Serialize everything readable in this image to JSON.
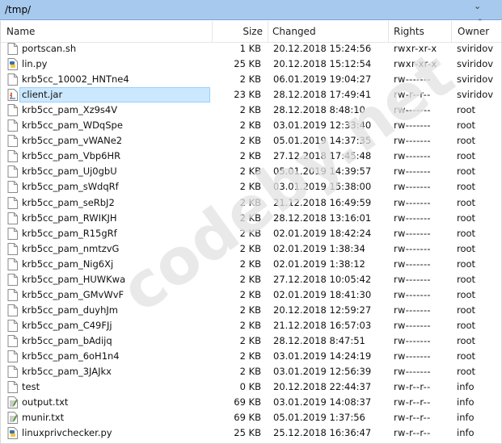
{
  "path": "/tmp/",
  "columns": {
    "name": "Name",
    "size": "Size",
    "changed": "Changed",
    "rights": "Rights",
    "owner": "Owner"
  },
  "watermark": "codeby.net",
  "selected_file": "client.jar",
  "files": [
    {
      "name": "portscan.sh",
      "size": "1 KB",
      "changed": "20.12.2018 15:24:56",
      "rights": "rwxr-xr-x",
      "owner": "sviridov",
      "icon": "file-icon"
    },
    {
      "name": "lin.py",
      "size": "25 KB",
      "changed": "20.12.2018 15:12:54",
      "rights": "rwxr-xr-x",
      "owner": "sviridov",
      "icon": "python-file-icon"
    },
    {
      "name": "krb5cc_10002_HNTne4",
      "size": "2 KB",
      "changed": "06.01.2019 19:04:27",
      "rights": "rw-------",
      "owner": "sviridov",
      "icon": "file-icon"
    },
    {
      "name": "client.jar",
      "size": "23 KB",
      "changed": "28.12.2018 17:49:41",
      "rights": "rw-r--r--",
      "owner": "sviridov",
      "icon": "jar-file-icon"
    },
    {
      "name": "krb5cc_pam_Xz9s4V",
      "size": "2 KB",
      "changed": "28.12.2018 8:48:10",
      "rights": "rw-------",
      "owner": "root",
      "icon": "file-icon"
    },
    {
      "name": "krb5cc_pam_WDqSpe",
      "size": "2 KB",
      "changed": "03.01.2019 12:33:40",
      "rights": "rw-------",
      "owner": "root",
      "icon": "file-icon"
    },
    {
      "name": "krb5cc_pam_vWANe2",
      "size": "2 KB",
      "changed": "05.01.2019 14:37:35",
      "rights": "rw-------",
      "owner": "root",
      "icon": "file-icon"
    },
    {
      "name": "krb5cc_pam_Vbp6HR",
      "size": "2 KB",
      "changed": "27.12.2018 17:45:48",
      "rights": "rw-------",
      "owner": "root",
      "icon": "file-icon"
    },
    {
      "name": "krb5cc_pam_Uj0gbU",
      "size": "2 KB",
      "changed": "05.01.2019 14:39:57",
      "rights": "rw-------",
      "owner": "root",
      "icon": "file-icon"
    },
    {
      "name": "krb5cc_pam_sWdqRf",
      "size": "2 KB",
      "changed": "03.01.2019 15:38:00",
      "rights": "rw-------",
      "owner": "root",
      "icon": "file-icon"
    },
    {
      "name": "krb5cc_pam_seRbJ2",
      "size": "2 KB",
      "changed": "21.12.2018 16:49:59",
      "rights": "rw-------",
      "owner": "root",
      "icon": "file-icon"
    },
    {
      "name": "krb5cc_pam_RWIKJH",
      "size": "2 KB",
      "changed": "28.12.2018 13:16:01",
      "rights": "rw-------",
      "owner": "root",
      "icon": "file-icon"
    },
    {
      "name": "krb5cc_pam_R15gRf",
      "size": "2 KB",
      "changed": "02.01.2019 18:42:24",
      "rights": "rw-------",
      "owner": "root",
      "icon": "file-icon"
    },
    {
      "name": "krb5cc_pam_nmtzvG",
      "size": "2 KB",
      "changed": "02.01.2019 1:38:34",
      "rights": "rw-------",
      "owner": "root",
      "icon": "file-icon"
    },
    {
      "name": "krb5cc_pam_Nig6Xj",
      "size": "2 KB",
      "changed": "02.01.2019 1:38:12",
      "rights": "rw-------",
      "owner": "root",
      "icon": "file-icon"
    },
    {
      "name": "krb5cc_pam_HUWKwa",
      "size": "2 KB",
      "changed": "27.12.2018 10:05:42",
      "rights": "rw-------",
      "owner": "root",
      "icon": "file-icon"
    },
    {
      "name": "krb5cc_pam_GMvWvF",
      "size": "2 KB",
      "changed": "02.01.2019 18:41:30",
      "rights": "rw-------",
      "owner": "root",
      "icon": "file-icon"
    },
    {
      "name": "krb5cc_pam_duyhJm",
      "size": "2 KB",
      "changed": "20.12.2018 12:59:27",
      "rights": "rw-------",
      "owner": "root",
      "icon": "file-icon"
    },
    {
      "name": "krb5cc_pam_C49FJj",
      "size": "2 KB",
      "changed": "21.12.2018 16:57:03",
      "rights": "rw-------",
      "owner": "root",
      "icon": "file-icon"
    },
    {
      "name": "krb5cc_pam_bAdijq",
      "size": "2 KB",
      "changed": "28.12.2018 8:47:51",
      "rights": "rw-------",
      "owner": "root",
      "icon": "file-icon"
    },
    {
      "name": "krb5cc_pam_6oH1n4",
      "size": "2 KB",
      "changed": "03.01.2019 14:24:19",
      "rights": "rw-------",
      "owner": "root",
      "icon": "file-icon"
    },
    {
      "name": "krb5cc_pam_3JAJkx",
      "size": "2 KB",
      "changed": "03.01.2019 12:56:39",
      "rights": "rw-------",
      "owner": "root",
      "icon": "file-icon"
    },
    {
      "name": "test",
      "size": "0 KB",
      "changed": "20.12.2018 22:44:37",
      "rights": "rw-r--r--",
      "owner": "info",
      "icon": "file-icon"
    },
    {
      "name": "output.txt",
      "size": "69 KB",
      "changed": "03.01.2019 14:08:37",
      "rights": "rw-r--r--",
      "owner": "info",
      "icon": "text-file-icon"
    },
    {
      "name": "munir.txt",
      "size": "69 KB",
      "changed": "05.01.2019 1:37:56",
      "rights": "rw-r--r--",
      "owner": "info",
      "icon": "text-file-icon"
    },
    {
      "name": "linuxprivchecker.py",
      "size": "25 KB",
      "changed": "25.12.2018 16:36:47",
      "rights": "rw-r--r--",
      "owner": "info",
      "icon": "python-file-icon"
    }
  ]
}
